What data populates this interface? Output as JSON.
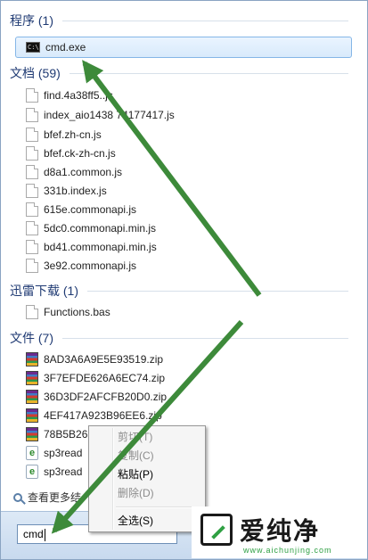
{
  "groups": [
    {
      "title": "程序 (1)",
      "items": [
        {
          "name": "cmd.exe",
          "icon": "cmd-icon"
        }
      ]
    },
    {
      "title": "文档 (59)",
      "items": [
        {
          "name": "find.4a38ff5..js",
          "icon": "document-icon"
        },
        {
          "name": "index_aio1438 74177417.js",
          "icon": "document-icon"
        },
        {
          "name": "bfef.zh-cn.js",
          "icon": "document-icon"
        },
        {
          "name": "bfef.ck-zh-cn.js",
          "icon": "document-icon"
        },
        {
          "name": "d8a1.common.js",
          "icon": "document-icon"
        },
        {
          "name": "331b.index.js",
          "icon": "document-icon"
        },
        {
          "name": "615e.commonapi.js",
          "icon": "document-icon"
        },
        {
          "name": "5dc0.commonapi.min.js",
          "icon": "document-icon"
        },
        {
          "name": "bd41.commonapi.min.js",
          "icon": "document-icon"
        },
        {
          "name": "3e92.commonapi.js",
          "icon": "document-icon"
        }
      ]
    },
    {
      "title": "迅雷下载 (1)",
      "items": [
        {
          "name": "Functions.bas",
          "icon": "document-icon"
        }
      ]
    },
    {
      "title": "文件 (7)",
      "items": [
        {
          "name": "8AD3A6A9E5E93519.zip",
          "icon": "zip-icon"
        },
        {
          "name": "3F7EFDE626A6EC74.zip",
          "icon": "zip-icon"
        },
        {
          "name": "36D3DF2AFCFB20D0.zip",
          "icon": "zip-icon"
        },
        {
          "name": "4EF417A923B96EE6.zip",
          "icon": "zip-icon"
        },
        {
          "name": "78B5B26",
          "icon": "zip-icon"
        },
        {
          "name": "sp3read",
          "icon": "ie-document-icon"
        },
        {
          "name": "sp3read",
          "icon": "ie-document-icon"
        }
      ]
    }
  ],
  "see_more": "查看更多结",
  "search": {
    "value": "cmd"
  },
  "context_menu": {
    "items": [
      {
        "label": "剪切(T)",
        "enabled": false
      },
      {
        "label": "复制(C)",
        "enabled": false
      },
      {
        "label": "粘贴(P)",
        "enabled": true
      },
      {
        "label": "删除(D)",
        "enabled": false
      },
      {
        "label": "全选(S)",
        "enabled": true
      }
    ]
  },
  "watermark": {
    "text": "爱纯净",
    "url": "www.aichunjing.com"
  },
  "colors": {
    "arrow": "#3d8a3a",
    "header": "#1f3a73",
    "selection_border": "#85b6e7"
  }
}
